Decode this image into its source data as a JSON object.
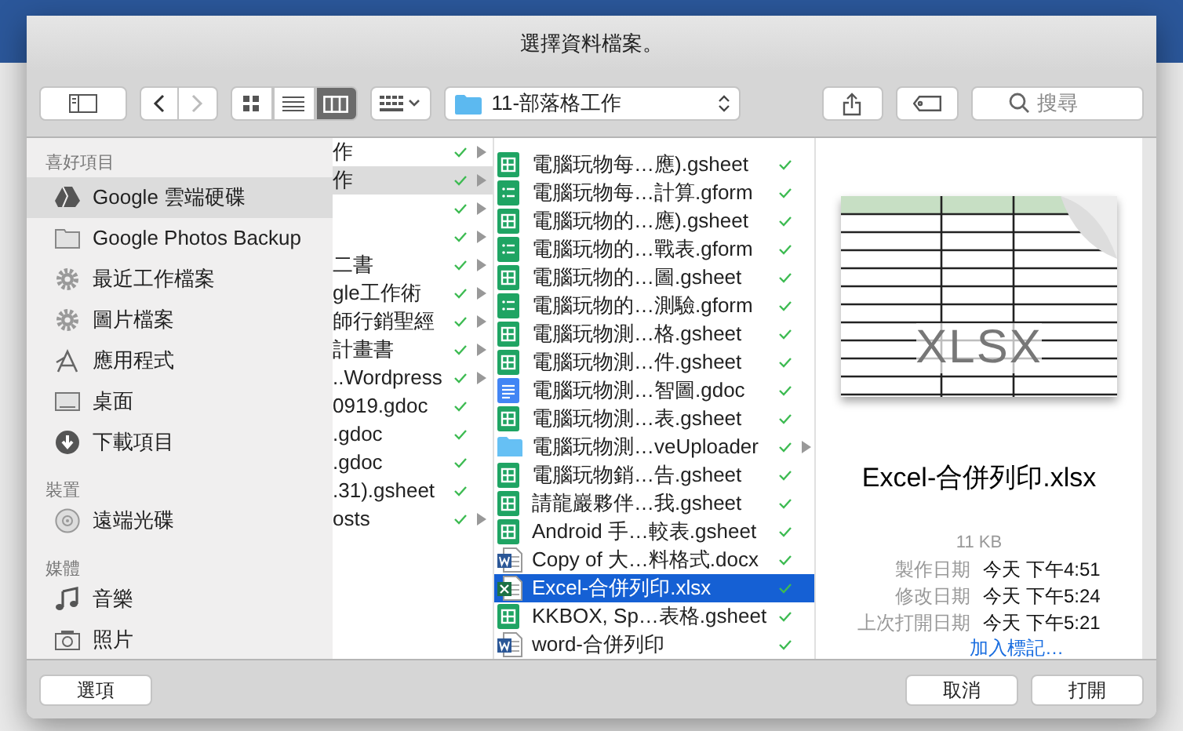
{
  "window": {
    "title": "選擇資料檔案。"
  },
  "toolbar": {
    "views": [
      {
        "kind": "icons",
        "selected": false
      },
      {
        "kind": "list",
        "selected": false
      },
      {
        "kind": "columns",
        "selected": true
      }
    ],
    "path": "11-部落格工作",
    "search": {
      "placeholder": "搜尋"
    },
    "forward_disabled": true
  },
  "sidebar": {
    "sections": [
      {
        "title": "喜好項目",
        "items": [
          {
            "label": "Google 雲端硬碟",
            "kind": "drive",
            "selected": true
          },
          {
            "label": "Google Photos Backup",
            "kind": "folder",
            "selected": false
          },
          {
            "label": "最近工作檔案",
            "kind": "gear",
            "selected": false
          },
          {
            "label": "圖片檔案",
            "kind": "gear",
            "selected": false
          },
          {
            "label": "應用程式",
            "kind": "apps",
            "selected": false
          },
          {
            "label": "桌面",
            "kind": "desktop",
            "selected": false
          },
          {
            "label": "下載項目",
            "kind": "download",
            "selected": false
          }
        ]
      },
      {
        "title": "裝置",
        "items": [
          {
            "label": "遠端光碟",
            "kind": "disc",
            "selected": false
          }
        ]
      },
      {
        "title": "媒體",
        "items": [
          {
            "label": "音樂",
            "kind": "music",
            "selected": false
          },
          {
            "label": "照片",
            "kind": "camera",
            "selected": false
          }
        ]
      }
    ]
  },
  "column_1": [
    {
      "name": "作",
      "selected": false,
      "has_children": true
    },
    {
      "name": "作",
      "selected": true,
      "has_children": true
    },
    {
      "selected": false,
      "has_children": true
    },
    {
      "selected": false,
      "has_children": true
    },
    {
      "name": "二書",
      "selected": false,
      "has_children": true
    },
    {
      "name": "gle工作術",
      "selected": false,
      "has_children": true
    },
    {
      "name": "師行銷聖經",
      "selected": false,
      "has_children": true
    },
    {
      "name": "計畫書",
      "selected": false,
      "has_children": true
    },
    {
      "name": "..Wordpress",
      "selected": false,
      "has_children": true
    },
    {
      "name": "0919.gdoc",
      "selected": false,
      "has_children": false
    },
    {
      "name": ".gdoc",
      "selected": false,
      "has_children": false
    },
    {
      "name": ".gdoc",
      "selected": false,
      "has_children": false
    },
    {
      "name": ".31).gsheet",
      "selected": false,
      "has_children": false
    },
    {
      "name": "osts",
      "selected": false,
      "has_children": true
    }
  ],
  "column_2": [
    {
      "name": "電腦玩物每…應).gsheet",
      "kind": "sheet",
      "selected": false
    },
    {
      "name": "電腦玩物每…計算.gform",
      "kind": "form",
      "selected": false
    },
    {
      "name": "電腦玩物的…應).gsheet",
      "kind": "sheet",
      "selected": false
    },
    {
      "name": "電腦玩物的…戰表.gform",
      "kind": "form",
      "selected": false
    },
    {
      "name": "電腦玩物的…圖.gsheet",
      "kind": "sheet",
      "selected": false
    },
    {
      "name": "電腦玩物的…測驗.gform",
      "kind": "form",
      "selected": false
    },
    {
      "name": "電腦玩物測…格.gsheet",
      "kind": "sheet",
      "selected": false
    },
    {
      "name": "電腦玩物測…件.gsheet",
      "kind": "sheet",
      "selected": false
    },
    {
      "name": "電腦玩物測…智圖.gdoc",
      "kind": "doc",
      "selected": false
    },
    {
      "name": "電腦玩物測…表.gsheet",
      "kind": "sheet",
      "selected": false
    },
    {
      "name": "電腦玩物測…veUploader",
      "kind": "folder",
      "selected": false
    },
    {
      "name": "電腦玩物銷…告.gsheet",
      "kind": "sheet",
      "selected": false
    },
    {
      "name": "請龍巖夥伴…我.gsheet",
      "kind": "sheet",
      "selected": false
    },
    {
      "name": "Android 手…較表.gsheet",
      "kind": "sheet",
      "selected": false
    },
    {
      "name": "Copy of 大…料格式.docx",
      "kind": "word",
      "selected": false
    },
    {
      "name": "Excel-合併列印.xlsx",
      "kind": "excel",
      "selected": true
    },
    {
      "name": "KKBOX, Sp…表格.gsheet",
      "kind": "sheet",
      "selected": false
    },
    {
      "name": "word-合併列印",
      "kind": "word",
      "selected": false
    }
  ],
  "preview": {
    "badge": "XLSX",
    "file_name": "Excel-合併列印.xlsx",
    "size": "11 KB",
    "details": [
      {
        "label": "製作日期",
        "value": "今天 下午4:51"
      },
      {
        "label": "修改日期",
        "value": "今天 下午5:24"
      },
      {
        "label": "上次打開日期",
        "value": "今天 下午5:21"
      }
    ],
    "link": "加入標記…"
  },
  "footer": {
    "options_button": "選項",
    "cancel_button": "取消",
    "open_button": "打開"
  }
}
